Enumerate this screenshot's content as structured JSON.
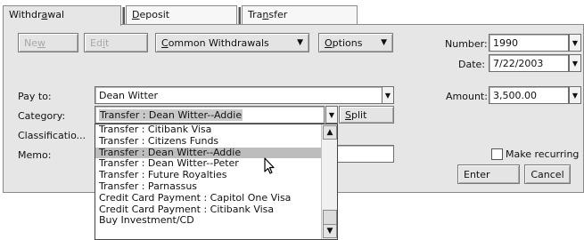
{
  "tabs": [
    {
      "label": "Withdrawal",
      "pre": "Withdr",
      "u": "a",
      "post": "wal"
    },
    {
      "label": "Deposit",
      "pre": "",
      "u": "D",
      "post": "eposit"
    },
    {
      "label": "Transfer",
      "pre": "Tra",
      "u": "n",
      "post": "sfer"
    }
  ],
  "toolbar": {
    "new_pre": "Ne",
    "new_u": "w",
    "edit_pre": "Ed",
    "edit_u": "i",
    "edit_post": "t",
    "common_pre": "",
    "common_u": "C",
    "common_post": "ommon Withdrawals",
    "options_pre": "",
    "options_u": "O",
    "options_post": "ptions"
  },
  "form": {
    "number_label": "Number:",
    "number_value": "1990",
    "date_label": "Date:",
    "date_value": "7/22/2003",
    "payto_label": "Pay to:",
    "payto_value": "Dean Witter",
    "amount_label": "Amount:",
    "amount_value": "3,500.00",
    "category_label": "Category:",
    "category_value": "Transfer : Dean Witter--Addie",
    "split_pre": "",
    "split_u": "S",
    "split_post": "plit",
    "classification_label": "Classificatio...",
    "memo_label": "Memo:",
    "recurring_label": "Make recurring",
    "enter_label": "Enter",
    "cancel_label": "Cancel"
  },
  "dropdown": {
    "items": [
      "Transfer : Citibank Visa",
      "Transfer : Citizens Funds",
      "Transfer : Dean Witter--Addie",
      "Transfer : Dean Witter--Peter",
      "Transfer : Future Royalties",
      "Transfer : Parnassus",
      "Credit Card Payment : Capitol One Visa",
      "Credit Card Payment : Citibank Visa",
      "Buy Investment/CD"
    ],
    "selected_index": 2
  }
}
